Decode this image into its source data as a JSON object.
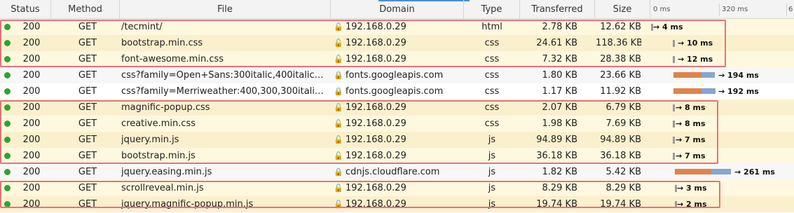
{
  "header": {
    "status": "Status",
    "method": "Method",
    "file": "File",
    "domain": "Domain",
    "type": "Type",
    "transferred": "Transferred",
    "size": "Size",
    "timeline_labels": [
      "0 ms",
      "320 ms",
      "6"
    ]
  },
  "rows": [
    {
      "status": "200",
      "method": "GET",
      "file": "/tecmint/",
      "domain": "192.168.0.29",
      "domain_icon": "insecure-icon",
      "type": "html",
      "transferred": "2.78 KB",
      "size": "12.62 KB",
      "timing": "→ 4 ms",
      "highlight": true
    },
    {
      "status": "200",
      "method": "GET",
      "file": "bootstrap.min.css",
      "domain": "192.168.0.29",
      "domain_icon": "insecure-icon",
      "type": "css",
      "transferred": "24.61 KB",
      "size": "118.36 KB",
      "timing": "→ 10 ms",
      "highlight": true
    },
    {
      "status": "200",
      "method": "GET",
      "file": "font-awesome.min.css",
      "domain": "192.168.0.29",
      "domain_icon": "insecure-icon",
      "type": "css",
      "transferred": "7.32 KB",
      "size": "28.38 KB",
      "timing": "→ 12 ms",
      "highlight": true
    },
    {
      "status": "200",
      "method": "GET",
      "file": "css?family=Open+Sans:300italic,400italic…",
      "domain": "fonts.googleapis.com",
      "domain_icon": "lock-icon",
      "type": "css",
      "transferred": "1.80 KB",
      "size": "23.66 KB",
      "timing": "→ 194 ms",
      "highlight": false
    },
    {
      "status": "200",
      "method": "GET",
      "file": "css?family=Merriweather:400,300,300itali…",
      "domain": "fonts.googleapis.com",
      "domain_icon": "lock-icon",
      "type": "css",
      "transferred": "1.17 KB",
      "size": "11.92 KB",
      "timing": "→ 192 ms",
      "highlight": false
    },
    {
      "status": "200",
      "method": "GET",
      "file": "magnific-popup.css",
      "domain": "192.168.0.29",
      "domain_icon": "insecure-icon",
      "type": "css",
      "transferred": "2.07 KB",
      "size": "6.79 KB",
      "timing": "→ 8 ms",
      "highlight": true
    },
    {
      "status": "200",
      "method": "GET",
      "file": "creative.min.css",
      "domain": "192.168.0.29",
      "domain_icon": "insecure-icon",
      "type": "css",
      "transferred": "1.98 KB",
      "size": "7.69 KB",
      "timing": "→ 8 ms",
      "highlight": true
    },
    {
      "status": "200",
      "method": "GET",
      "file": "jquery.min.js",
      "domain": "192.168.0.29",
      "domain_icon": "insecure-icon",
      "type": "js",
      "transferred": "94.89 KB",
      "size": "94.89 KB",
      "timing": "→ 7 ms",
      "highlight": true
    },
    {
      "status": "200",
      "method": "GET",
      "file": "bootstrap.min.js",
      "domain": "192.168.0.29",
      "domain_icon": "insecure-icon",
      "type": "js",
      "transferred": "36.18 KB",
      "size": "36.18 KB",
      "timing": "→ 7 ms",
      "highlight": true
    },
    {
      "status": "200",
      "method": "GET",
      "file": "jquery.easing.min.js",
      "domain": "cdnjs.cloudflare.com",
      "domain_icon": "lock-icon",
      "type": "js",
      "transferred": "1.82 KB",
      "size": "5.42 KB",
      "timing": "→ 261 ms",
      "highlight": false
    },
    {
      "status": "200",
      "method": "GET",
      "file": "scrollreveal.min.js",
      "domain": "192.168.0.29",
      "domain_icon": "insecure-icon",
      "type": "js",
      "transferred": "8.29 KB",
      "size": "8.29 KB",
      "timing": "→ 3 ms",
      "highlight": true
    },
    {
      "status": "200",
      "method": "GET",
      "file": "jquery.magnific-popup.min.js",
      "domain": "192.168.0.29",
      "domain_icon": "insecure-icon",
      "type": "js",
      "transferred": "19.74 KB",
      "size": "19.74 KB",
      "timing": "→ 2 ms",
      "highlight": true
    }
  ],
  "colors": {
    "status_ok": "#2da52d",
    "highlight_row": "#fef8de",
    "group_border": "#e8727a",
    "timing_wait": "#e0834a",
    "timing_receive": "#85a6ce"
  }
}
